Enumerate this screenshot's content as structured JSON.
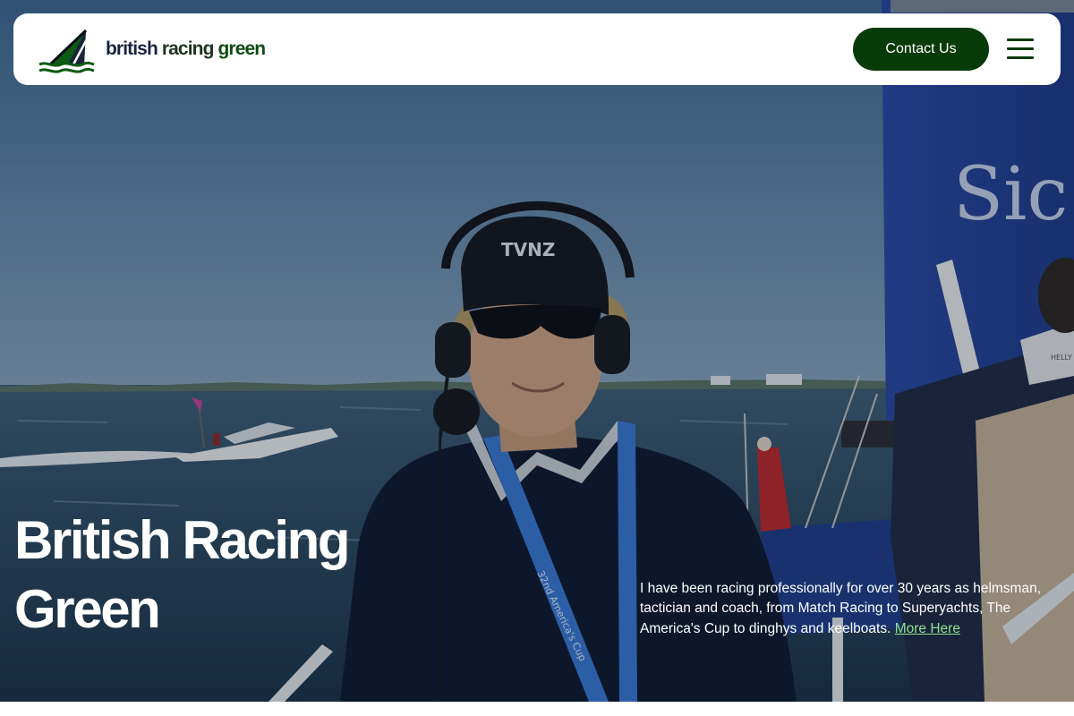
{
  "header": {
    "brand_words": [
      "british",
      "racing",
      "green"
    ],
    "contact_label": "Contact Us"
  },
  "hero": {
    "title": "British Racing Green",
    "description": "I have been racing professionally for over 30 years as helmsman, tactician and coach, from Match Racing to Superyachts, The America's Cup to dinghys and keelboats.",
    "link_text": "More Here",
    "cap_text": "TVNZ",
    "sail_text": "Sic",
    "lanyard_text": "32nd America's Cup",
    "jacket_text": "HELLY"
  },
  "icons": {
    "logo": "sailboat-logo-icon",
    "menu": "hamburger-menu-icon"
  },
  "colors": {
    "brand_green": "#073b07",
    "link_green": "#8fe08f",
    "sail_blue": "#2747a0"
  }
}
